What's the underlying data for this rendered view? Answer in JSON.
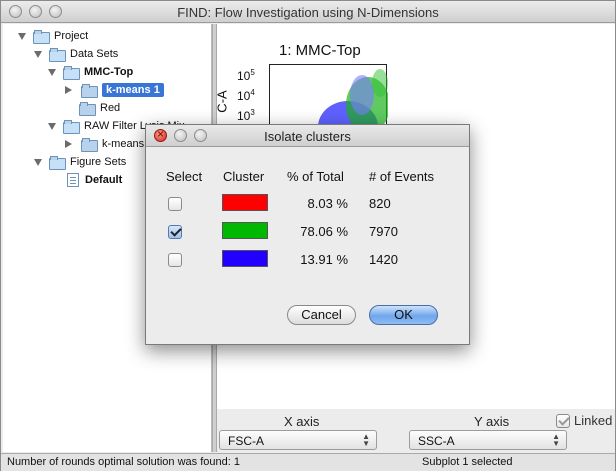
{
  "window": {
    "title": "FIND: Flow Investigation using N-Dimensions"
  },
  "tree": {
    "items": [
      {
        "label": "Project",
        "icon": "folder-star-icon"
      },
      {
        "label": "Data Sets",
        "icon": "folder-star-icon"
      },
      {
        "label": "MMC-Top",
        "icon": "folder-star-icon"
      },
      {
        "label": "k-means 1",
        "icon": "folder-icon",
        "selected": true
      },
      {
        "label": "Red",
        "icon": "folder-icon"
      },
      {
        "label": "RAW Filter Lysis Mix",
        "icon": "folder-star-icon"
      },
      {
        "label": "k-means",
        "icon": "folder-icon"
      },
      {
        "label": "Figure Sets",
        "icon": "folder-star-icon"
      },
      {
        "label": "Default",
        "icon": "document-icon"
      }
    ]
  },
  "plot": {
    "title": "1: MMC-Top",
    "ylabel": "C-A",
    "yticks": [
      "10",
      "10",
      "10"
    ],
    "yexp": [
      "5",
      "4",
      "3"
    ]
  },
  "bottom": {
    "x_axis_label": "X axis",
    "y_axis_label": "Y axis",
    "x_axis_value": "FSC-A",
    "y_axis_value": "SSC-A",
    "linked_label": "Linked",
    "linked_checked": true
  },
  "status": {
    "left": "Number of rounds optimal solution was found: 1",
    "right": "Subplot 1 selected"
  },
  "dialog": {
    "title": "Isolate clusters",
    "headers": {
      "select": "Select",
      "cluster": "Cluster",
      "pct": "% of Total",
      "events": "# of Events"
    },
    "rows": [
      {
        "checked": false,
        "color": "#ff0000",
        "pct": "8.03 %",
        "events": "820"
      },
      {
        "checked": true,
        "color": "#00b800",
        "pct": "78.06 %",
        "events": "7970"
      },
      {
        "checked": false,
        "color": "#2200ff",
        "pct": "13.91 %",
        "events": "1420"
      }
    ],
    "cancel_label": "Cancel",
    "ok_label": "OK"
  }
}
